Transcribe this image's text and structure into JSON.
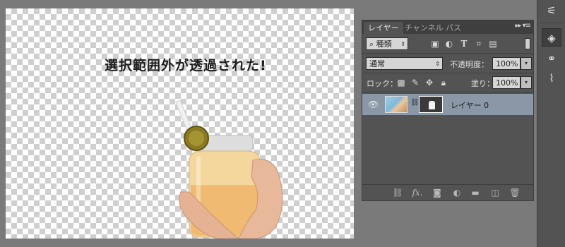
{
  "canvas": {
    "caption": "選択範囲外が透過された!"
  },
  "layers_panel": {
    "tabs": [
      {
        "label": "レイヤー",
        "active": true
      },
      {
        "label": "チャンネル",
        "active": false
      },
      {
        "label": "パス",
        "active": false
      }
    ],
    "filter": {
      "search_glyph": "⌕",
      "kind_value": "種類",
      "icons": [
        "image-filter-icon",
        "adjustment-filter-icon",
        "type-filter-icon",
        "shape-filter-icon",
        "smart-object-filter-icon"
      ]
    },
    "blend_mode": "通常",
    "opacity": {
      "label": "不透明度：",
      "value": "100%"
    },
    "lock": {
      "label": "ロック：",
      "icons": [
        "lock-transparent-icon",
        "lock-image-icon",
        "lock-position-icon",
        "lock-all-icon"
      ]
    },
    "fill": {
      "label": "塗り：",
      "value": "100%"
    },
    "layers": [
      {
        "name": "レイヤー 0",
        "visible": true,
        "has_mask": true
      }
    ],
    "bottom_icons": [
      "link-layers-icon",
      "fx-icon",
      "add-mask-icon",
      "adjustment-layer-icon",
      "group-folder-icon",
      "new-layer-icon",
      "trash-icon"
    ],
    "fx_text": "fx."
  },
  "colors": {
    "panel_bg": "#535353",
    "selected_layer": "#8a97a6",
    "workspace_bg": "#7a7a7a"
  }
}
